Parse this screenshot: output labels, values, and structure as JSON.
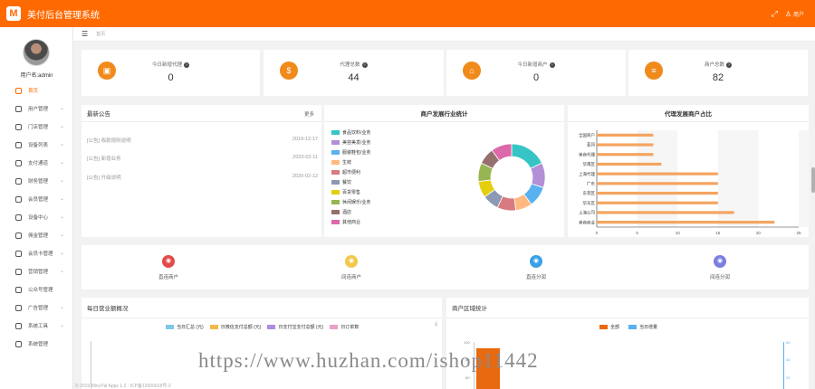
{
  "app": {
    "logo_letter": "M",
    "title": "美付后台管理系统",
    "user_label": "用户",
    "expand_icon": "expand-icon",
    "user_icon": "user-icon"
  },
  "sidebar": {
    "username": "用户名:admin",
    "items": [
      {
        "label": "首页",
        "icon": "home-icon",
        "active": true
      },
      {
        "label": "用户管理",
        "icon": "user-icon"
      },
      {
        "label": "门店管理",
        "icon": "store-icon"
      },
      {
        "label": "设备列表",
        "icon": "device-icon"
      },
      {
        "label": "支付通道",
        "icon": "pay-icon"
      },
      {
        "label": "财务管理",
        "icon": "finance-icon"
      },
      {
        "label": "会员管理",
        "icon": "member-icon"
      },
      {
        "label": "设备中心",
        "icon": "device-center-icon"
      },
      {
        "label": "佣金管理",
        "icon": "commission-icon"
      },
      {
        "label": "会员卡管理",
        "icon": "card-icon"
      },
      {
        "label": "营销管理",
        "icon": "marketing-icon"
      },
      {
        "label": "公众号管理",
        "icon": "wechat-icon"
      },
      {
        "label": "广告管理",
        "icon": "ad-icon"
      },
      {
        "label": "系统工具",
        "icon": "tools-icon"
      },
      {
        "label": "系统管理",
        "icon": "settings-icon"
      }
    ]
  },
  "breadcrumb": {
    "label": "首页"
  },
  "stats": [
    {
      "label": "今日新增代理",
      "value": "0",
      "color": "#f08a1b"
    },
    {
      "label": "代理总数",
      "value": "44",
      "color": "#f08a1b"
    },
    {
      "label": "今日新增商户",
      "value": "0",
      "color": "#f08a1b"
    },
    {
      "label": "商户总数",
      "value": "82",
      "color": "#f08a1b"
    }
  ],
  "notices": {
    "title": "最新公告",
    "more": "更多",
    "items": [
      {
        "text": "[公告] 收款规则说明",
        "date": "2019-12-17"
      },
      {
        "text": "[公告] 新增业务",
        "date": "2020-02-11"
      },
      {
        "text": "[公告] 升级说明",
        "date": "2020-02-12"
      }
    ]
  },
  "industry": {
    "title": "商户发展行业统计",
    "chart_data": {
      "type": "pie",
      "categories": [
        "食品饮料/业务",
        "美容美发/业务",
        "服装鞋包/业务",
        "生鲜",
        "超市便利",
        "餐饮",
        "百货零售",
        "休闲娱乐/业务",
        "酒店",
        "其他商业"
      ],
      "values": [
        18,
        12,
        10,
        8,
        9,
        8,
        8,
        9,
        8,
        10
      ],
      "colors": [
        "#36c5c4",
        "#b28fd6",
        "#5ab1ef",
        "#ffb980",
        "#d87a80",
        "#8d98b3",
        "#e5cf0d",
        "#97b552",
        "#95706d",
        "#dc69aa"
      ]
    }
  },
  "agents": {
    "title": "代理发展商户占比",
    "chart_data": {
      "type": "bar",
      "orientation": "horizontal",
      "categories": [
        "全国商户",
        "亚同",
        "美商代理",
        "华南区",
        "上海代理",
        "广东",
        "东莞区",
        "华东区",
        "上海公司",
        "美商商业"
      ],
      "values": [
        7,
        7,
        7,
        8,
        15,
        15,
        15,
        15,
        17,
        22
      ],
      "xlim": [
        0,
        25
      ],
      "xticks": [
        "0",
        "5",
        "10",
        "15",
        "20",
        "25"
      ],
      "color": "#f4a460"
    }
  },
  "quick": [
    {
      "label": "直连商户",
      "color": "#e34b4b",
      "icon": "store-icon"
    },
    {
      "label": "间连商户",
      "color": "#f2c94c",
      "icon": "shop-icon"
    },
    {
      "label": "直连分润",
      "color": "#3aa0e6",
      "icon": "share-icon"
    },
    {
      "label": "间连分润",
      "color": "#7b7fe0",
      "icon": "split-icon"
    }
  ],
  "daily": {
    "title": "每日营业额概况",
    "legend": [
      {
        "label": "当日汇总 (元)",
        "color": "#7fc8e8"
      },
      {
        "label": "日微信支付总额 (元)",
        "color": "#f2b94a"
      },
      {
        "label": "日支付宝支付总额 (元)",
        "color": "#b08de0"
      },
      {
        "label": "日订单数",
        "color": "#e8a0c8"
      }
    ]
  },
  "region": {
    "title": "商户区域统计",
    "legend": [
      {
        "label": "全部",
        "color": "#e8690f"
      },
      {
        "label": "当日增量",
        "color": "#5ab1ef"
      }
    ],
    "yaxis_left": [
      "100",
      "80",
      "60"
    ],
    "yaxis_right": [
      "60",
      "40",
      "20"
    ]
  },
  "footer": {
    "text": "© 2019 Mini.Pal Apps 1.2 · ICP备12000018号-2"
  },
  "watermark": {
    "text": "https://www.huzhan.com/ishop11442"
  }
}
